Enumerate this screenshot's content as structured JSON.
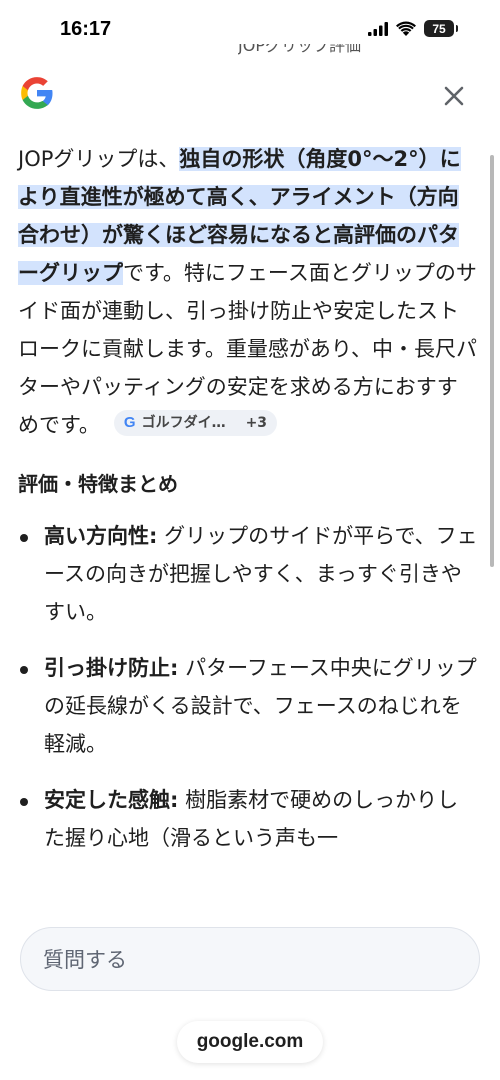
{
  "status_bar": {
    "time": "16:17",
    "battery": "75",
    "icons": [
      "signal-icon",
      "wifi-icon",
      "battery-icon"
    ]
  },
  "background_peek_text": "JOPグリップ評価",
  "header": {
    "logo": "google-g-logo",
    "close_icon": "close-icon"
  },
  "answer": {
    "intro_plain": "JOPグリップは、",
    "intro_highlight": "独自の形状（角度0°〜2°）により直進性が極めて高く、アライメント（方向合わせ）が驚くほど容易になると高評価のパターグリップ",
    "body": "です。特にフェース面とグリップのサイド面が連動し、引っ掛け防止や安定したストロークに貢献します。重量感があり、中・長尺パターやパッティングの安定を求める方におすすめです。",
    "source_chip": {
      "icon": "G",
      "label": "ゴルフダイ…",
      "more": "+3"
    }
  },
  "summary": {
    "heading": "評価・特徴まとめ",
    "items": [
      {
        "title": "高い方向性:",
        "text": " グリップのサイドが平らで、フェースの向きが把握しやすく、まっすぐ引きやすい。"
      },
      {
        "title": "引っ掛け防止:",
        "text": " パターフェース中央にグリップの延長線がくる設計で、フェースのねじれを軽減。"
      },
      {
        "title": "安定した感触:",
        "text": " 樹脂素材で硬めのしっかりした握り心地（滑るという声も一"
      }
    ]
  },
  "ask": {
    "placeholder": "質問する"
  },
  "url_bar": {
    "domain": "google.com"
  },
  "colors": {
    "highlight": "#d3e3fd",
    "google_blue": "#4285f4",
    "google_red": "#ea4335",
    "google_yellow": "#fbbc05",
    "google_green": "#34a853"
  }
}
